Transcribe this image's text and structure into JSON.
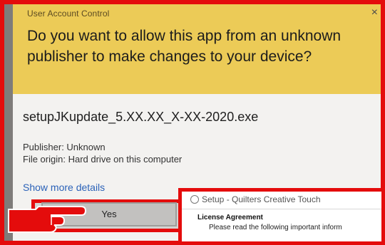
{
  "uac": {
    "title": "User Account Control",
    "close_symbol": "×",
    "question": "Do you want to allow this app from an unknown publisher to make changes to your device?",
    "app_name": "setupJKupdate_5.XX.XX_X-XX-2020.exe",
    "publisher": "Publisher: Unknown",
    "file_origin": "File origin: Hard drive on this computer",
    "show_details": "Show more details",
    "yes_label": "Yes"
  },
  "setup_window": {
    "title": "Setup - Quilters Creative Touch",
    "heading": "License Agreement",
    "subtext": "Please read the following important inform"
  },
  "colors": {
    "highlight": "#e40c0c",
    "uac_header": "#eccb57",
    "link": "#2b62b8"
  },
  "icons": [
    "close-icon",
    "pointing-hand-icon",
    "setup-app-icon"
  ]
}
